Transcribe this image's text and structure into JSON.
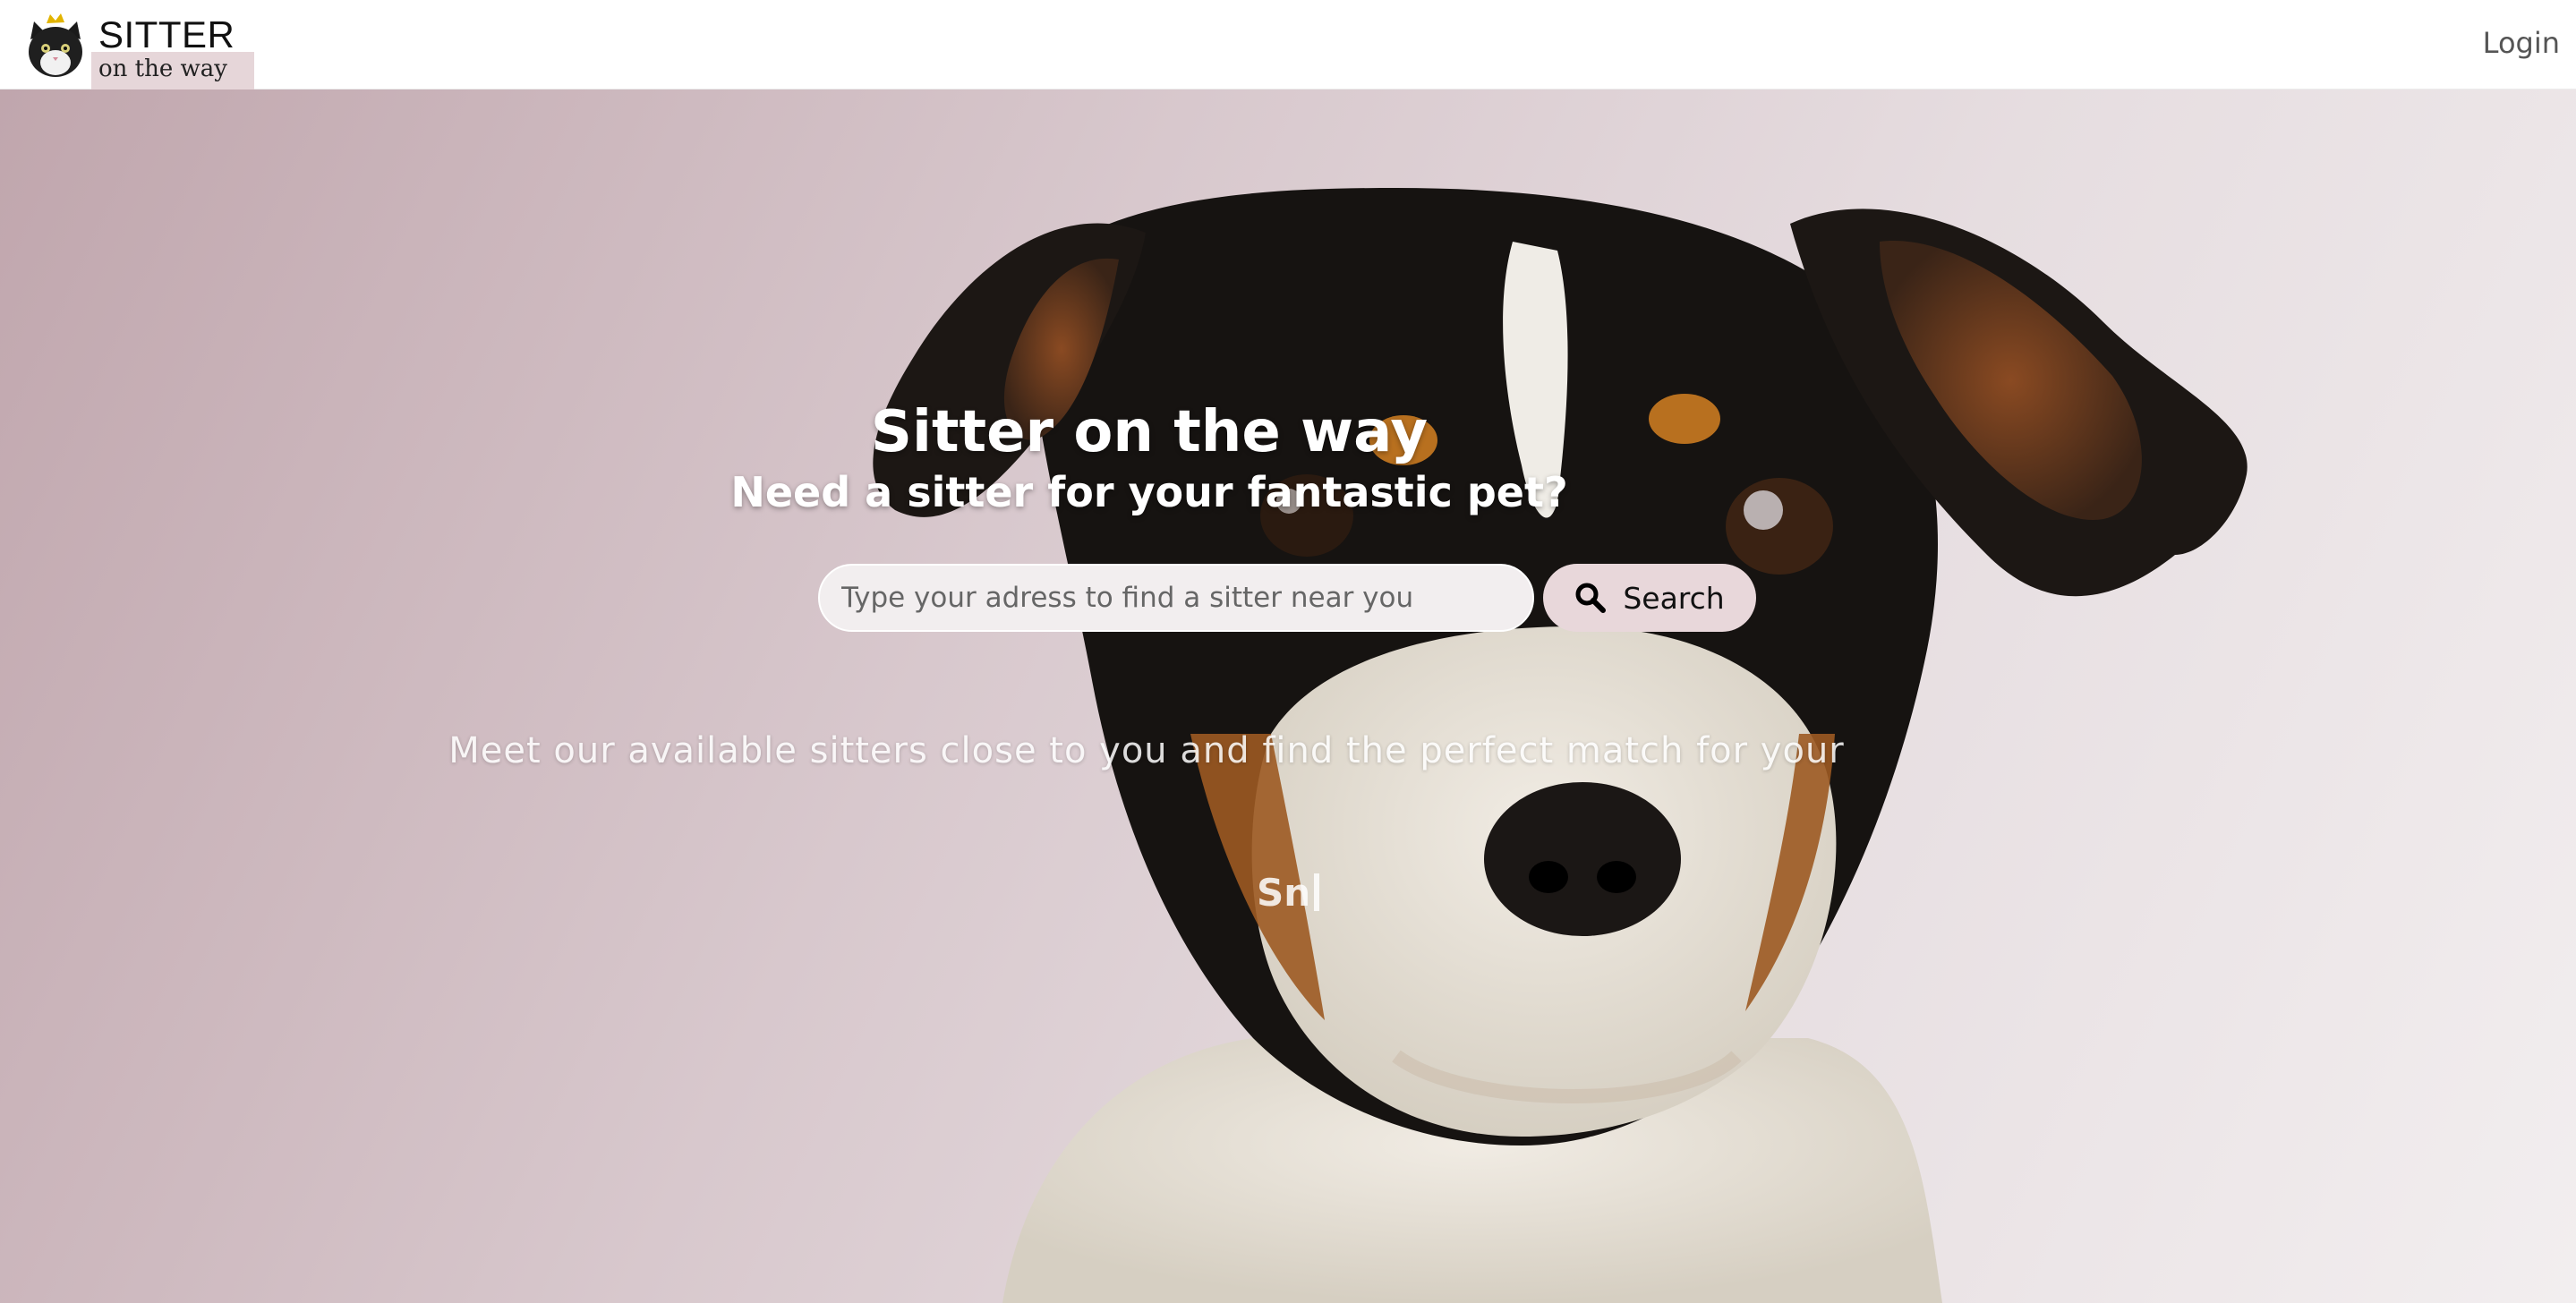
{
  "header": {
    "logo_title": "SITTER",
    "logo_subtitle": "on the way",
    "login_label": "Login"
  },
  "hero": {
    "title": "Sitter on the way",
    "subtitle": "Need a sitter for your fantastic pet?",
    "search": {
      "placeholder": "Type your adress to find a sitter near you",
      "value": "",
      "button_label": "Search",
      "icon": "search-icon"
    },
    "tagline": "Meet our available sitters close to you and find the perfect match for your",
    "typed_word": "Sn"
  },
  "colors": {
    "accent_button": "#e8d7da",
    "logo_highlight": "#e6d6d9",
    "hero_text": "#ffffff",
    "login_text": "#555555"
  }
}
